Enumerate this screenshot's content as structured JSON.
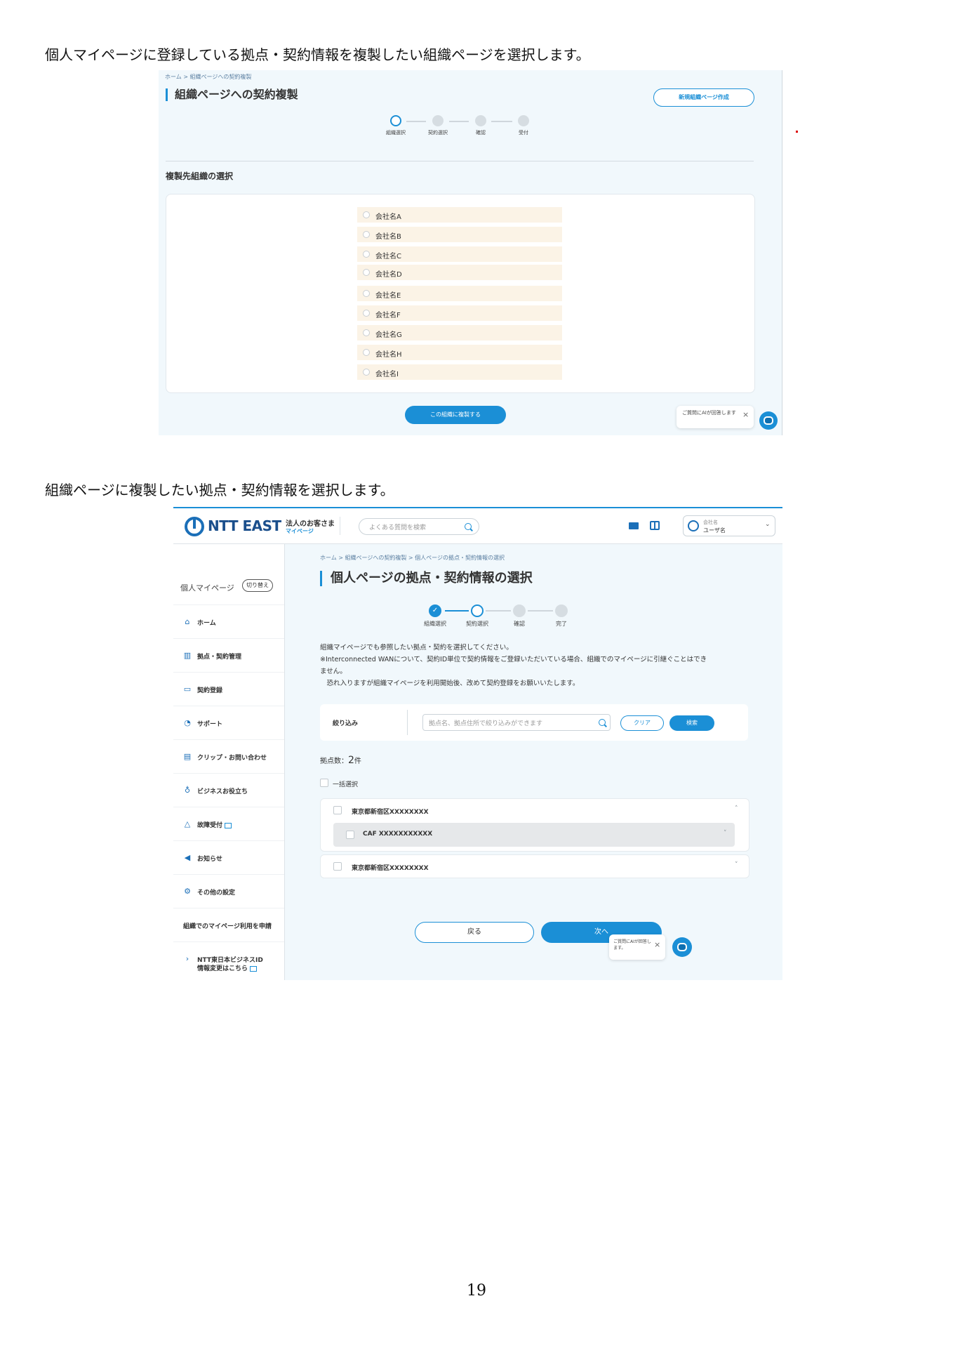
{
  "captions": {
    "first": "個人マイページに登録している拠点・契約情報を複製したい組織ページを選択します。",
    "second": "組織ページに複製したい拠点・契約情報を選択します。"
  },
  "page_number": "19",
  "screen1": {
    "breadcrumb": "ホーム > 組織ページへの契約複製",
    "title": "組織ページへの契約複製",
    "new_org_button": "新規組織ページ作成",
    "steps": [
      "組織選択",
      "契約選択",
      "確認",
      "受付"
    ],
    "section_title": "複製先組織の選択",
    "companies": [
      "会社名A",
      "会社名B",
      "会社名C",
      "会社名D",
      "会社名E",
      "会社名F",
      "会社名G",
      "会社名H",
      "会社名I"
    ],
    "copy_button": "この組織に複製する",
    "ai_bubble": "ご質問にAIが回答します"
  },
  "screen2": {
    "logo": "NTT EAST",
    "header_corp": "法人のお客さま",
    "header_mypage": "マイページ",
    "search_placeholder": "よくある質問を検索",
    "user_company": "会社名",
    "user_name": "ユーザ名",
    "sidebar": {
      "title": "個人マイページ",
      "toggle": "切り替え",
      "items": [
        "ホーム",
        "拠点・契約管理",
        "契約登録",
        "サポート",
        "クリップ・お問い合わせ",
        "ビジネスお役立ち",
        "故障受付",
        "お知らせ",
        "その他の設定",
        "組織でのマイページ利用を申請",
        "NTT東日本ビジネスID",
        "情報変更はこちら"
      ]
    },
    "breadcrumb": "ホーム > 組織ページへの契約複製 > 個人ページの拠点・契約情報の選択",
    "title": "個人ページの拠点・契約情報の選択",
    "steps": [
      "組織選択",
      "契約選択",
      "確認",
      "完了"
    ],
    "description": [
      "組織マイページでも参照したい拠点・契約を選択してください。",
      "※Interconnected WANについて、契約ID単位で契約情報をご登録いただいている場合、組織でのマイページに引継ぐことはでき",
      "ません。",
      "　恐れ入りますが組織マイページを利用開始後、改めて契約登録をお願いいたします。"
    ],
    "filter_label": "絞り込み",
    "filter_placeholder": "拠点名、拠点住所で絞り込みができます",
    "clear_button": "クリア",
    "search_button": "検索",
    "count_label": "拠点数：",
    "count_value": "2",
    "count_unit": "件",
    "bulk_select": "一括選択",
    "locations": [
      {
        "name": "東京都新宿区XXXXXXXX",
        "contracts": [
          "CAF XXXXXXXXXXX"
        ]
      },
      {
        "name": "東京都新宿区XXXXXXXX",
        "contracts": []
      }
    ],
    "back_button": "戻る",
    "next_button": "次へ",
    "ai_bubble": "ご質問にAIが回答します。"
  },
  "colors": {
    "accent": "#1b8fd6",
    "panel_bg": "#f1f8fc",
    "option_bg": "#fbf3e6"
  },
  "icons": [
    "search-icon",
    "mail-icon",
    "manual-book-icon",
    "user-icon",
    "home-icon",
    "building-icon",
    "contract-icon",
    "support-icon",
    "clip-icon",
    "bulb-icon",
    "warning-icon",
    "megaphone-icon",
    "gear-icon",
    "chevron-right-icon",
    "external-link-icon",
    "close-icon",
    "ai-robot-icon",
    "check-icon",
    "caret-up-icon",
    "caret-down-icon"
  ]
}
